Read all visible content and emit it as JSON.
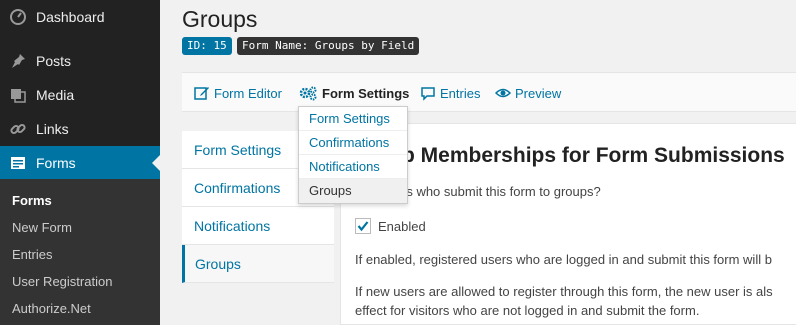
{
  "sidebar": {
    "items": [
      {
        "label": "Dashboard",
        "icon": "dashboard-icon"
      },
      {
        "label": "Posts",
        "icon": "pin-icon"
      },
      {
        "label": "Media",
        "icon": "media-icon"
      },
      {
        "label": "Links",
        "icon": "link-icon"
      },
      {
        "label": "Forms",
        "icon": "forms-icon"
      }
    ],
    "submenu": [
      "Forms",
      "New Form",
      "Entries",
      "User Registration",
      "Authorize.Net"
    ]
  },
  "header": {
    "title": "Groups",
    "id_badge": "ID: 15",
    "form_badge": "Form Name: Groups by Field"
  },
  "toolbar": {
    "form_editor": "Form Editor",
    "form_settings": "Form Settings",
    "entries": "Entries",
    "preview": "Preview"
  },
  "dropdown": {
    "items": [
      "Form Settings",
      "Confirmations",
      "Notifications",
      "Groups"
    ]
  },
  "tabs": [
    "Form Settings",
    "Confirmations",
    "Notifications",
    "Groups"
  ],
  "content": {
    "title": "p Memberships for Form Submissions",
    "question": "rs who submit this form to groups?",
    "checkbox_label": "Enabled",
    "checkbox_checked": true,
    "para1": "If enabled, registered users who are logged in and submit this form will b",
    "para2_line1": "If new users are allowed to register through this form, the new user is als",
    "para2_line2": "effect for visitors who are not logged in and submit the form."
  },
  "colors": {
    "accent": "#0074a2",
    "sidebar_bg": "#222222"
  }
}
